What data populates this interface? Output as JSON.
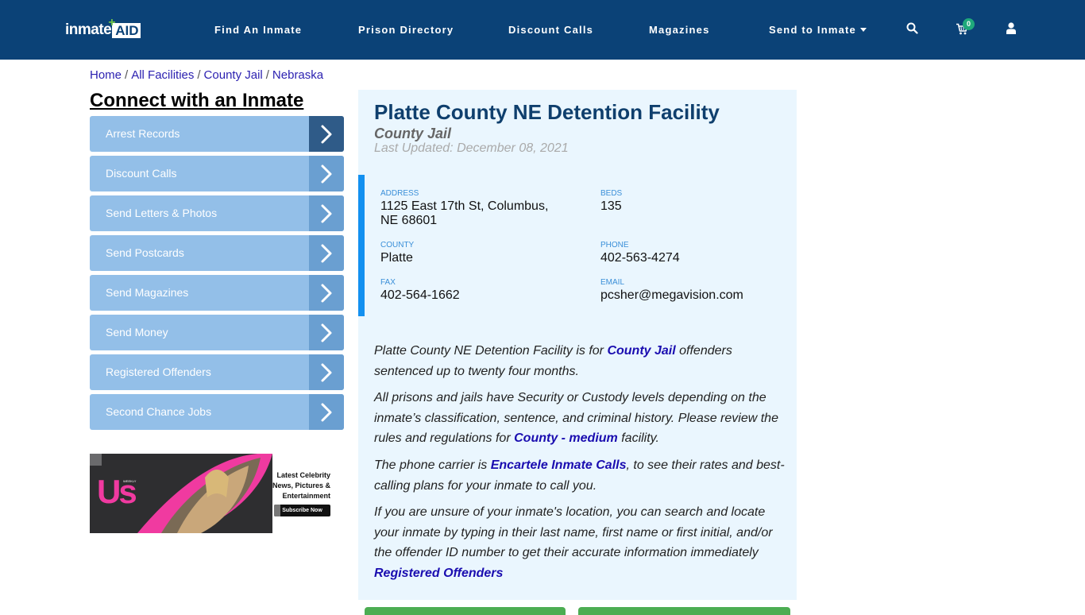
{
  "brand": {
    "logo_text_1": "inmate",
    "logo_text_2": "AID",
    "logo_plus": "+",
    "navy": "#0b4277",
    "accent_green": "#6cc04a"
  },
  "nav": {
    "links": [
      {
        "label": "Find An Inmate"
      },
      {
        "label": "Prison Directory"
      },
      {
        "label": "Discount Calls"
      },
      {
        "label": "Magazines"
      },
      {
        "label": "Send to Inmate",
        "dropdown": true
      }
    ],
    "icons": {
      "search": "search-icon",
      "cart": "cart-icon",
      "user": "user-icon"
    },
    "cart_count": "0"
  },
  "breadcrumb": {
    "items": [
      "Home",
      "All Facilities",
      "County Jail",
      "Nebraska"
    ],
    "separator": "/"
  },
  "sidebar": {
    "title": "Connect with an Inmate",
    "items": [
      {
        "label": "Arrest Records"
      },
      {
        "label": "Discount Calls"
      },
      {
        "label": "Send Letters & Photos"
      },
      {
        "label": "Send Postcards"
      },
      {
        "label": "Send Magazines"
      },
      {
        "label": "Send Money"
      },
      {
        "label": "Registered Offenders"
      },
      {
        "label": "Second Chance Jobs"
      }
    ]
  },
  "ad": {
    "brand": "Us",
    "brand_sub": "WEEKLY",
    "headline_1": "Latest Celebrity",
    "headline_2": "News, Pictures &",
    "headline_3": "Entertainment",
    "cta": "Subscribe Now"
  },
  "facility": {
    "name": "Platte County NE Detention Facility",
    "type": "County Jail",
    "last_updated": "Last Updated: December 08, 2021",
    "fields": {
      "address": {
        "label": "ADDRESS",
        "value_line1": "1125 East 17th St, Columbus,",
        "value_line2": "NE 68601"
      },
      "beds": {
        "label": "BEDS",
        "value": "135"
      },
      "county": {
        "label": "COUNTY",
        "value": "Platte"
      },
      "phone": {
        "label": "PHONE",
        "value": "402-563-4274"
      },
      "fax": {
        "label": "FAX",
        "value": "402-564-1662"
      },
      "email": {
        "label": "EMAIL",
        "value": "pcsher@megavision.com"
      }
    }
  },
  "description": {
    "p1_a": "Platte County NE Detention Facility is for ",
    "p1_link": "County Jail",
    "p1_b": " offenders sentenced up to twenty four months.",
    "p2_a": "All prisons and jails have Security or Custody levels depending on the inmate’s classification, sentence, and criminal history. Please review the rules and regulations for ",
    "p2_link": "County - medium",
    "p2_b": " facility.",
    "p3_a": "The phone carrier is ",
    "p3_link": "Encartele Inmate Calls",
    "p3_b": ", to see their rates and best-calling plans for your inmate to call you.",
    "p4_a": "If you are unsure of your inmate's location, you can search and locate your inmate by typing in their last name, first name or first initial, and/or the offender ID number to get their accurate information immediately ",
    "p4_link": "Registered Offenders"
  }
}
